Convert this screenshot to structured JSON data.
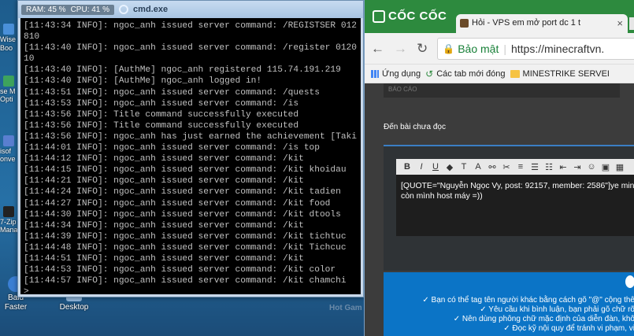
{
  "desktop": {
    "left_icons": [
      {
        "label": "Wise",
        "color": "#4a90d9"
      },
      {
        "label": "Boo",
        "color": "#e07b2d"
      },
      {
        "label": "se M",
        "color": "#3da35d"
      },
      {
        "label": "Opti",
        "color": "#3da35d"
      },
      {
        "label": "isof",
        "color": "#5a7fd0"
      },
      {
        "label": "onve",
        "color": "#5a7fd0"
      },
      {
        "label": "7-Zip",
        "color": "#222222"
      },
      {
        "label": "Mana",
        "color": "#222222"
      }
    ],
    "bottom_icons": [
      {
        "label_1": "Baid",
        "label_2": "Faster"
      },
      {
        "label_1": "",
        "label_2": "Desktop"
      }
    ]
  },
  "cmd": {
    "ram": "RAM: 45 %",
    "cpu": "CPU: 41 %",
    "title": "cmd.exe",
    "lines": [
      "[11:43:34 INFO]: ngoc_anh issued server command: /REGISTSER 012",
      "810",
      "[11:43:40 INFO]: ngoc_anh issued server command: /register 0120",
      "10",
      "[11:43:40 INFO]: [AuthMe] ngoc_anh registered 115.74.191.219",
      "[11:43:40 INFO]: [AuthMe] ngoc_anh logged in!",
      "[11:43:51 INFO]: ngoc_anh issued server command: /quests",
      "[11:43:53 INFO]: ngoc_anh issued server command: /is",
      "[11:43:56 INFO]: Title command successfully executed",
      "[11:43:56 INFO]: Title command successfully executed",
      "[11:43:56 INFO]: ngoc_anh has just earned the achievement [Taki",
      "[11:44:01 INFO]: ngoc_anh issued server command: /is top",
      "[11:44:12 INFO]: ngoc_anh issued server command: /kit",
      "[11:44:15 INFO]: ngoc_anh issued server command: /kit khoidau",
      "[11:44:21 INFO]: ngoc_anh issued server command: /kit",
      "[11:44:24 INFO]: ngoc_anh issued server command: /kit tadien",
      "[11:44:27 INFO]: ngoc_anh issued server command: /kit food",
      "[11:44:30 INFO]: ngoc_anh issued server command: /kit dtools",
      "[11:44:34 INFO]: ngoc_anh issued server command: /kit",
      "[11:44:39 INFO]: ngoc_anh issued server command: /kit tichtuc",
      "[11:44:48 INFO]: ngoc_anh issued server command: /kit Tichcuc",
      "[11:44:51 INFO]: ngoc_anh issued server command: /kit",
      "[11:44:53 INFO]: ngoc_anh issued server command: /kit color",
      "[11:44:57 INFO]: ngoc_anh issued server command: /kit chamchi",
      ">"
    ]
  },
  "browser": {
    "brand": "CỐC CỐC",
    "tab_title": "Hỏi - VPS em mở port dc 1 t",
    "security_label": "Bảo mật",
    "url": "https://minecraftvn.",
    "bookmarks": [
      "Ứng dụng",
      "Các tab mới đóng",
      "MINESTRIKE SERVEI"
    ],
    "page": {
      "top_label": "BÁO CÁO",
      "section_title": "Đến bài chưa đọc",
      "editor_text_1": "[QUOTE=\"Nguyễn Ngọc Vy, post: 92157, member: 2586\"]ye min",
      "editor_text_2": "còn mình host máy =))",
      "rules": [
        "✓ Bạn có thể tag tên người khác bằng cách gõ \"@\" cộng thê",
        "✓ Yêu cầu khi bình luận, bạn phải gõ chữ rõ",
        "✓ Nên dùng phông chữ mặc định của diễn đàn, khô",
        "✓ Đọc kỹ nội quy để tránh vi phạm, vi"
      ]
    }
  },
  "background": {
    "hot_game": "Hot Gam"
  }
}
